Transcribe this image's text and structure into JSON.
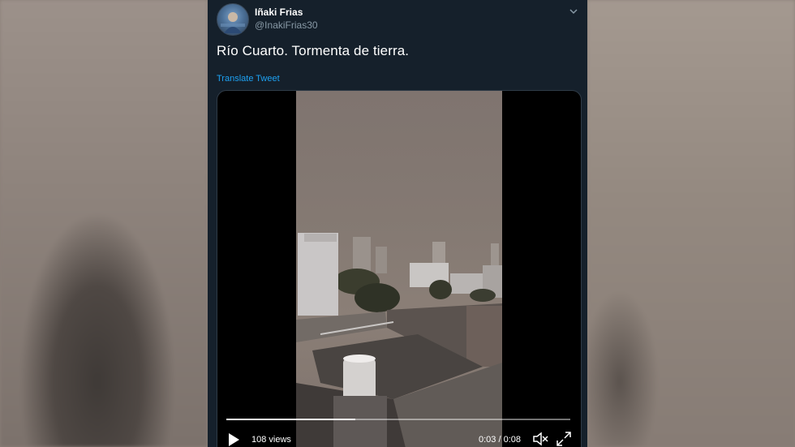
{
  "tweet": {
    "author_name": "Iñaki Frias",
    "author_handle": "@InakiFrias30",
    "text": "Río Cuarto. Tormenta de tierra.",
    "translate_label": "Translate Tweet"
  },
  "video": {
    "views": "108 views",
    "time": "0:03 / 0:08",
    "progress": 0.375
  },
  "icons": {
    "menu": "chevron-down-icon",
    "play": "play-icon",
    "volume": "volume-muted-icon",
    "fullscreen": "fullscreen-icon"
  },
  "colors": {
    "tweet_bg": "#15202b",
    "link": "#1da1f2",
    "handle": "#8899a6"
  }
}
